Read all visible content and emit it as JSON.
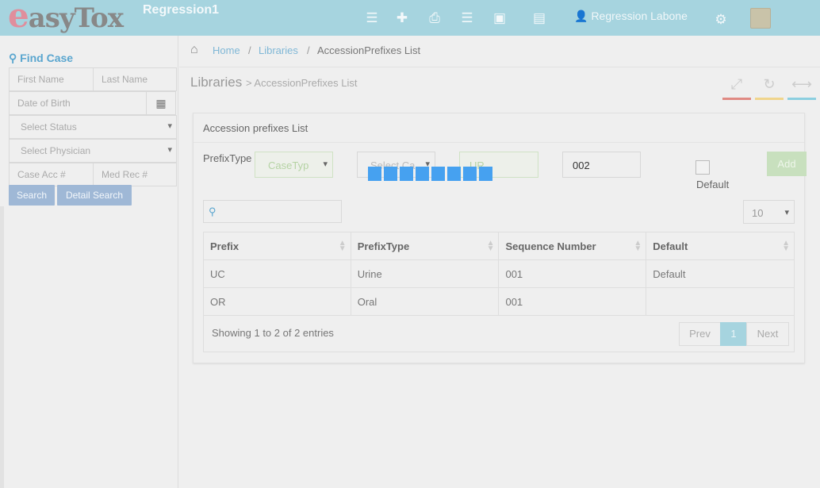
{
  "header": {
    "logo_text": "easyTox",
    "logo_first": "e",
    "logo_rest": "asyTox",
    "app_title": "Regression1",
    "icons": [
      "list-icon",
      "plus-icon",
      "print-icon",
      "list-icon",
      "briefcase-icon",
      "card-icon",
      "settings-icon",
      "logout-icon"
    ],
    "user_name": "Regression Labone"
  },
  "sidebar": {
    "title": "Find Case",
    "first_name": "First Name",
    "last_name": "Last Name",
    "dob": "Date of Birth",
    "status": "Select Status",
    "physician": "Select Physician",
    "case_acc": "Case Acc #",
    "med_rec": "Med Rec #",
    "search": "Search",
    "detail_search": "Detail Search"
  },
  "breadcrumb": {
    "home": "Home",
    "sep": "/",
    "libraries": "Libraries",
    "current": "AccessionPrefixes List"
  },
  "page": {
    "title": "Libraries",
    "subtitle": "> AccessionPrefixes List",
    "action_colors": [
      "#e08a83",
      "#f0d58c",
      "#8ccfe0"
    ]
  },
  "panel": {
    "title": "Accession prefixes List",
    "prefix_type_label": "PrefixType",
    "case_type_value": "CaseTyp",
    "select_case_value": "Select Ca",
    "prefix_value": "UR",
    "sequence_value": "002",
    "default_label": "Default",
    "add_label": "Add",
    "page_length": "10",
    "search_placeholder": ""
  },
  "table": {
    "headers": [
      "Prefix",
      "PrefixType",
      "Sequence Number",
      "Default"
    ],
    "rows": [
      [
        "UC",
        "Urine",
        "001",
        "Default"
      ],
      [
        "OR",
        "Oral",
        "001",
        ""
      ]
    ],
    "info": "Showing 1 to 2 of 2 entries"
  },
  "pagination": {
    "prev": "Prev",
    "page": "1",
    "next": "Next"
  },
  "colors": {
    "header_bg": "#a6d4df",
    "link": "#7fb7d6",
    "loader": "#46a1f0"
  }
}
